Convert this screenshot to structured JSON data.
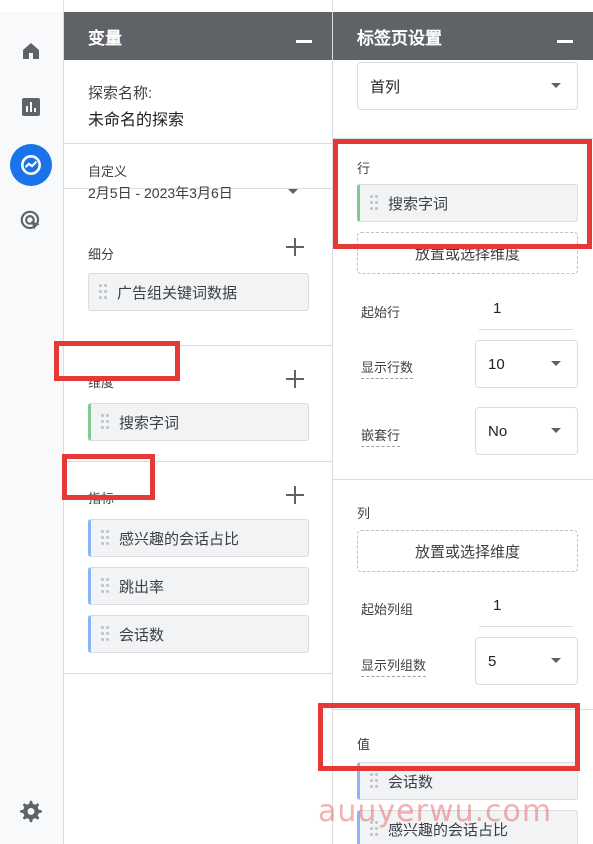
{
  "variables_panel": {
    "title": "变量",
    "exploration_name_label": "探索名称:",
    "exploration_name_value": "未命名的探索",
    "date_custom_label": "自定义",
    "date_range": "2月5日 - 2023年3月6日",
    "segments_label": "细分",
    "segments": [
      "广告组关键词数据"
    ],
    "dimensions_label": "维度",
    "dimensions": [
      "搜索字词"
    ],
    "metrics_label": "指标",
    "metrics": [
      "感兴趣的会话占比",
      "跳出率",
      "会话数"
    ]
  },
  "tab_settings_panel": {
    "title": "标签页设置",
    "first_select_value": "首列",
    "rows_label": "行",
    "rows_chip": "搜索字词",
    "rows_drop_placeholder": "放置或选择维度",
    "start_row_label": "起始行",
    "start_row_value": "1",
    "show_rows_label": "显示行数",
    "show_rows_value": "10",
    "nested_rows_label": "嵌套行",
    "nested_rows_value": "No",
    "columns_label": "列",
    "columns_drop_placeholder": "放置或选择维度",
    "start_col_group_label": "起始列组",
    "start_col_group_value": "1",
    "show_col_groups_label": "显示列组数",
    "show_col_groups_value": "5",
    "values_label": "值",
    "values": [
      "会话数",
      "感兴趣的会话占比"
    ]
  },
  "watermark": "auuyerwu.com",
  "colors": {
    "highlight": "#e53935",
    "rail_active": "#1a73e8",
    "header_bg": "#5f6368"
  }
}
